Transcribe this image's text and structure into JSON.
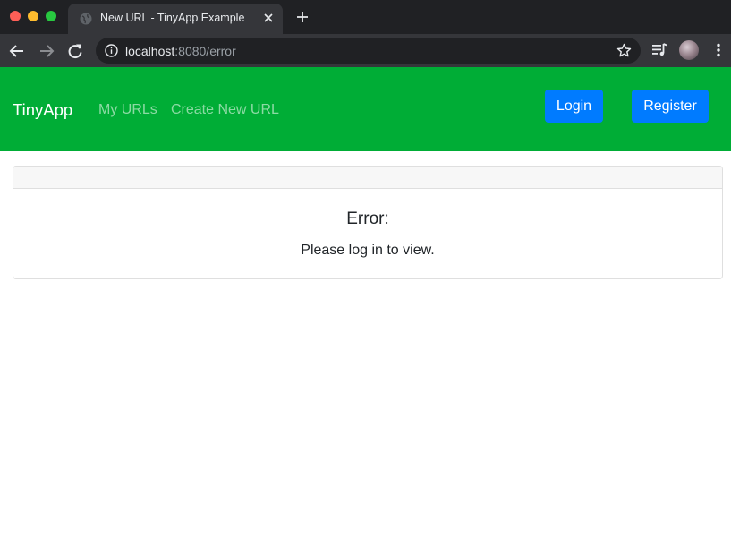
{
  "browser": {
    "tab_title": "New URL - TinyApp Example",
    "url_host": "localhost",
    "url_rest": ":8080/error",
    "icons": {
      "favicon": "globe-icon",
      "close": "close-icon",
      "new_tab": "plus-icon",
      "back": "back-arrow-icon",
      "forward": "forward-arrow-icon",
      "reload": "reload-icon",
      "site_info": "info-icon",
      "bookmark": "star-icon",
      "media": "media-playlist-icon",
      "profile": "avatar",
      "menu": "kebab-menu-icon"
    }
  },
  "navbar": {
    "brand": "TinyApp",
    "links": [
      "My URLs",
      "Create New URL"
    ],
    "login_label": "Login",
    "register_label": "Register",
    "colors": {
      "background": "#00ad36",
      "button": "#007bff"
    }
  },
  "error_card": {
    "title": "Error:",
    "message": "Please log in to view."
  }
}
